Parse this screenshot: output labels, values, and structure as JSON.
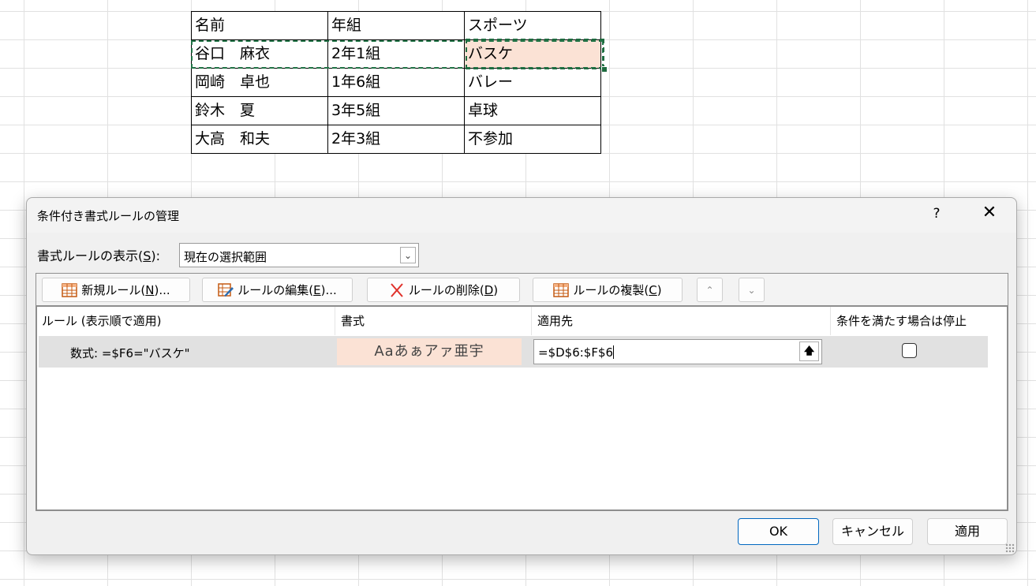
{
  "sheet": {
    "rows": [
      [
        "名前",
        "年組",
        "スポーツ"
      ],
      [
        "谷口　麻衣",
        "2年1組",
        "バスケ"
      ],
      [
        "岡崎　卓也",
        "1年6組",
        "バレー"
      ],
      [
        "鈴木　夏",
        "3年5組",
        "卓球"
      ],
      [
        "大高　和夫",
        "2年3組",
        "不参加"
      ]
    ],
    "highlight_color": "#fbe2d5",
    "selection_color": "#217346"
  },
  "dialog": {
    "title": "条件付き書式ルールの管理",
    "help": "?",
    "close": "✕",
    "show_label_pre": "書式ルールの表示(",
    "show_label_key": "S",
    "show_label_post": "):",
    "show_select_value": "現在の選択範囲",
    "toolbar": {
      "new_rule": {
        "pre": "新規ルール(",
        "key": "N",
        "post": ")..."
      },
      "edit_rule": {
        "pre": "ルールの編集(",
        "key": "E",
        "post": ")..."
      },
      "delete_rule": {
        "pre": "ルールの削除(",
        "key": "D",
        "post": ")"
      },
      "duplicate_rule": {
        "pre": "ルールの複製(",
        "key": "C",
        "post": ")"
      },
      "move_up": "⌃",
      "move_down": "⌄"
    },
    "columns": {
      "rule": "ルール (表示順で適用)",
      "format": "書式",
      "applies_to": "適用先",
      "stop_if_true": "条件を満たす場合は停止"
    },
    "rule": {
      "condition": "数式: =$F6=\"バスケ\"",
      "format_preview": "Aaあぁアァ亜宇",
      "applies_to": "=$D$6:$F$6",
      "stop_if_true": false
    },
    "buttons": {
      "ok": "OK",
      "cancel": "キャンセル",
      "apply": "適用"
    },
    "accent_color": "#0067c0"
  }
}
